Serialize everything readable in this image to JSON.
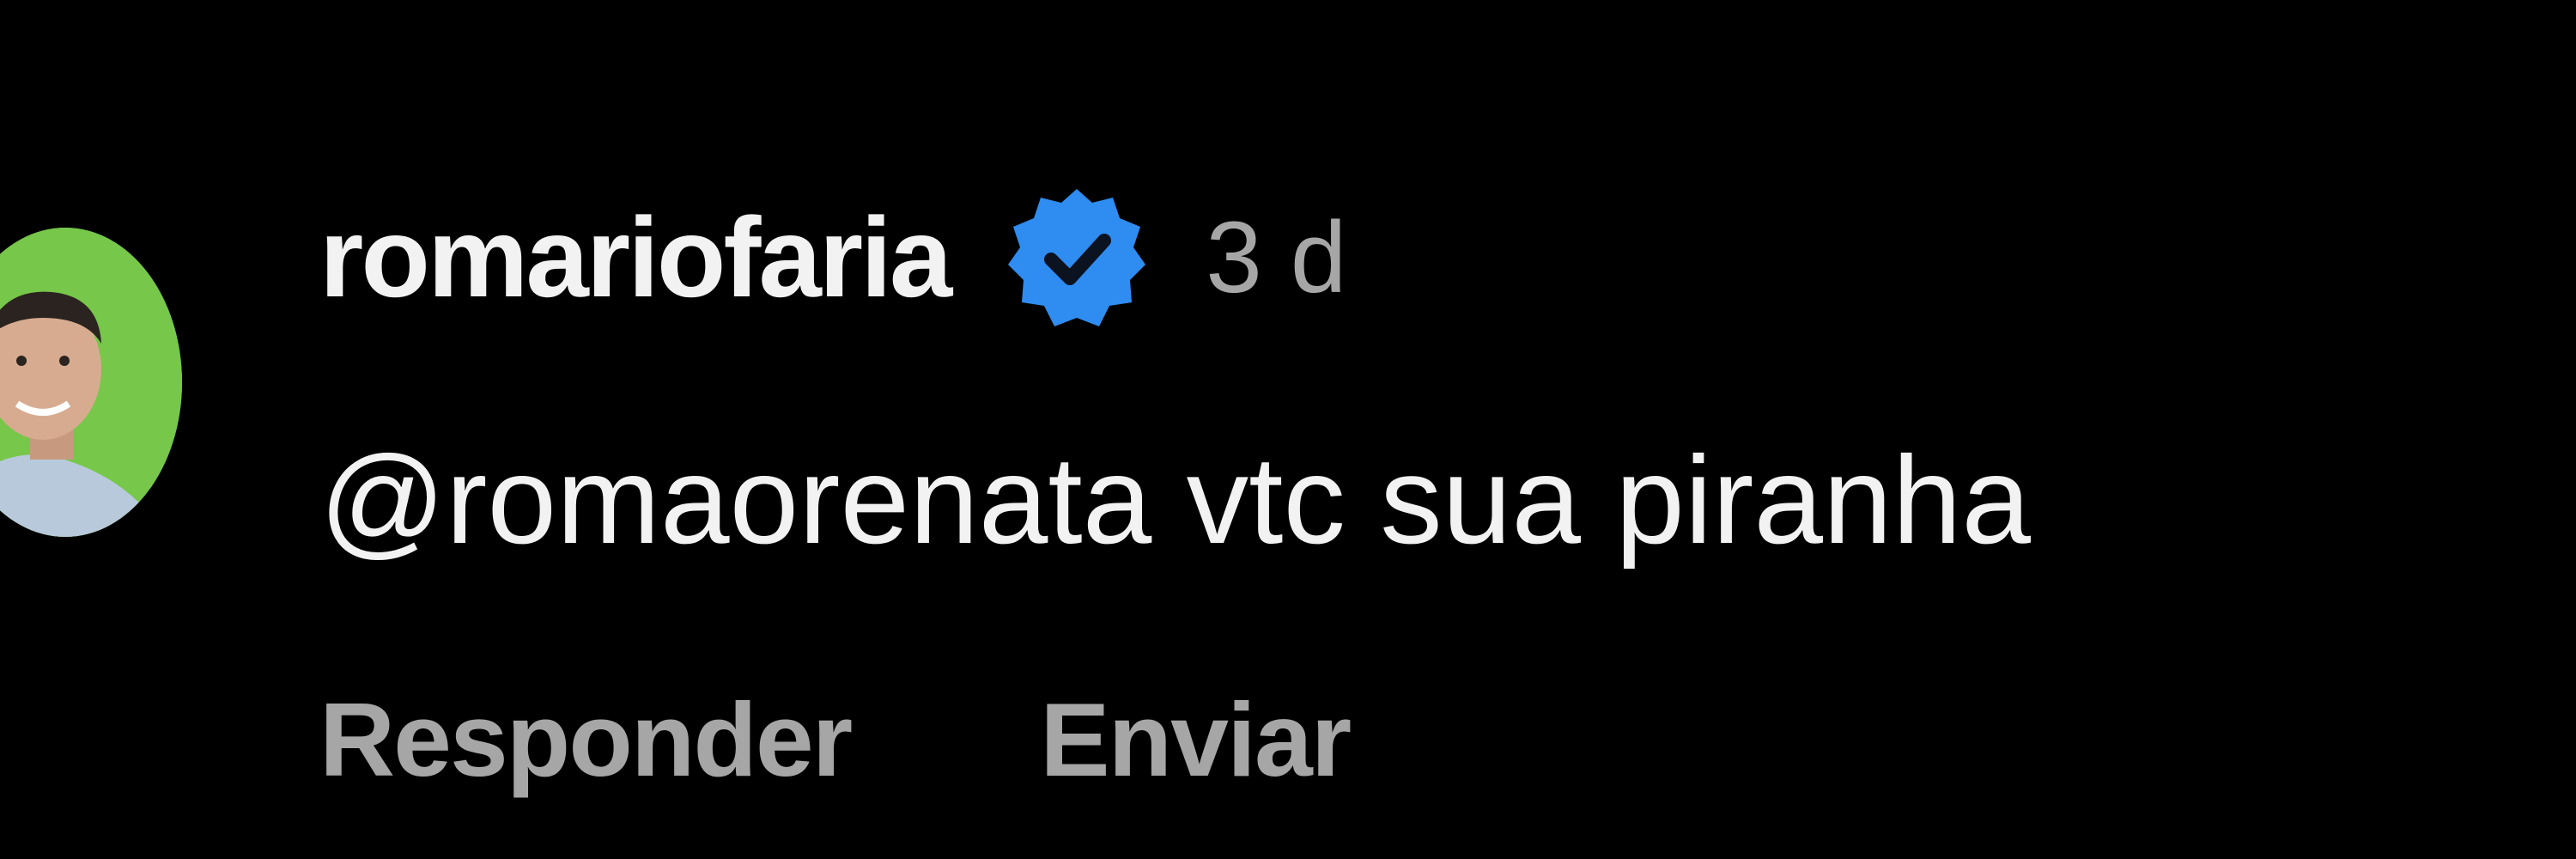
{
  "comment": {
    "username": "romariofaria",
    "verified_icon": "verified-badge-icon",
    "timestamp": "3 d",
    "mention": "@romaorenata",
    "text": " vtc sua piranha",
    "actions": {
      "reply_label": "Responder",
      "send_label": "Enviar"
    }
  },
  "colors": {
    "background": "#000000",
    "text_primary": "#f2f2f2",
    "text_secondary": "#a6a6a6",
    "verified_blue": "#2f8cf0",
    "avatar_ring": "#76c74a"
  }
}
